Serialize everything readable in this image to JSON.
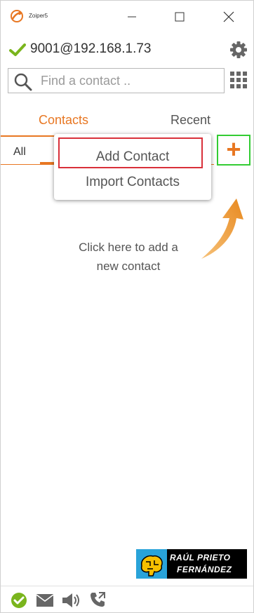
{
  "window": {
    "app_title": "Zoiper5"
  },
  "account": {
    "name": "9001@192.168.1.73"
  },
  "search": {
    "placeholder": "Find a contact .."
  },
  "tabs": {
    "contacts": "Contacts",
    "recent": "Recent"
  },
  "filter": {
    "all": "All"
  },
  "add_menu": {
    "add_contact": "Add Contact",
    "import_contacts": "Import Contacts"
  },
  "hint": {
    "line1": "Click here to add a",
    "line2": "new contact"
  },
  "watermark": {
    "line1": "RAÚL PRIETO",
    "line2": "FERNÁNDEZ"
  },
  "colors": {
    "accent": "#e87722",
    "status_ok": "#7ab51d",
    "highlight_add_button": "#33cc33",
    "highlight_menu_item": "#d9303a"
  },
  "icons": [
    "zoiper-logo-icon",
    "minimize-icon",
    "maximize-icon",
    "close-icon",
    "checkmark-icon",
    "gear-icon",
    "search-icon",
    "dialpad-icon",
    "plus-icon",
    "arrow-icon",
    "online-status-icon",
    "mail-icon",
    "speaker-icon",
    "call-forward-icon"
  ]
}
